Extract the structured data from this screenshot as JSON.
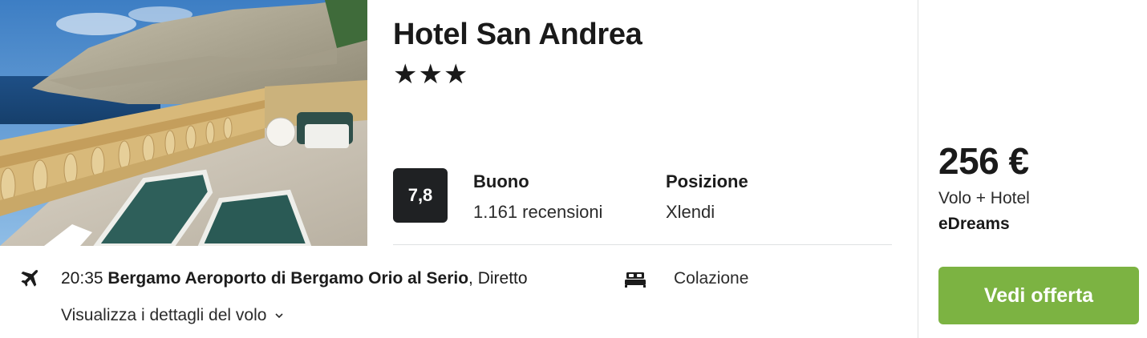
{
  "hotel": {
    "name": "Hotel San Andrea",
    "stars": "★★★",
    "score": "7,8",
    "rating_label": "Buono",
    "reviews": "1.161 recensioni",
    "location_label": "Posizione",
    "location_value": "Xlendi"
  },
  "flight": {
    "time": "20:35",
    "airport": "Bergamo Aeroporto di Bergamo Orio al Serio",
    "type": ", Diretto",
    "details_link": "Visualizza i dettagli del volo",
    "icon": "plane-icon"
  },
  "board": {
    "icon": "bed-icon",
    "label": "Colazione"
  },
  "offer": {
    "price": "256 €",
    "package": "Volo + Hotel",
    "provider": "eDreams",
    "cta": "Vedi offerta"
  },
  "colors": {
    "cta_green": "#7cb342",
    "score_bg": "#1f2123",
    "divider": "#dfe1e3"
  }
}
